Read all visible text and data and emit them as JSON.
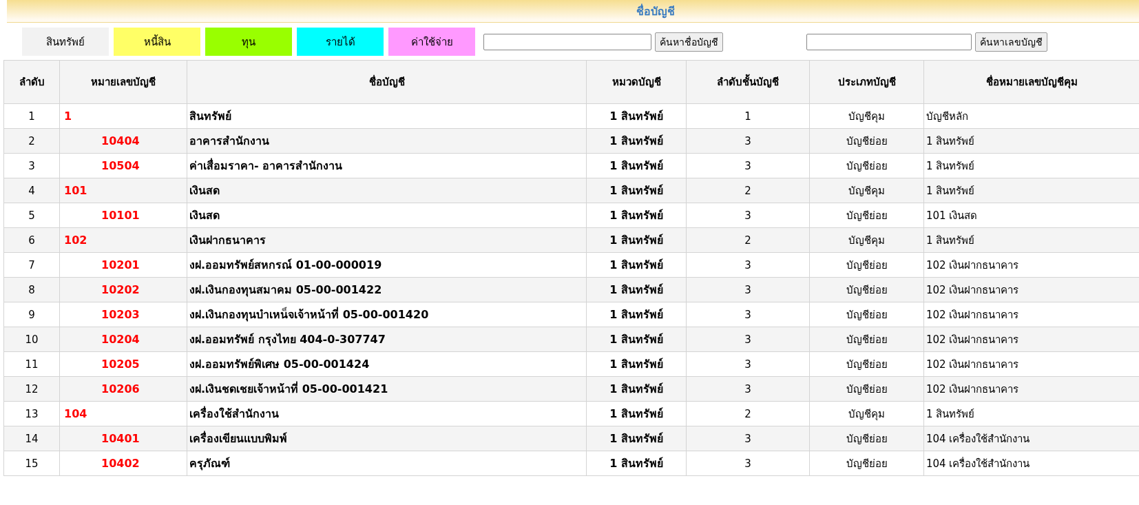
{
  "page_title": "ชื่อบัญชี",
  "categories": [
    {
      "label": "สินทรัพย์",
      "color": "#f2f2f2"
    },
    {
      "label": "หนี้สิน",
      "color": "#ffff66"
    },
    {
      "label": "ทุน",
      "color": "#99ff00"
    },
    {
      "label": "รายได้",
      "color": "#00ffff"
    },
    {
      "label": "ค่าใช้จ่าย",
      "color": "#ff99ff"
    }
  ],
  "searches": [
    {
      "button": "ค้นหาชื่อบัญชี"
    },
    {
      "button": "ค้นหาเลขบัญชี"
    }
  ],
  "table": {
    "columns": [
      "ลำดับ",
      "หมายเลขบัญชี",
      "ชื่อบัญชี",
      "หมวดบัญชี",
      "ลำดับชั้นบัญชี",
      "ประเภทบัญชี",
      "ชื่อหมายเลขบัญชีคุม"
    ],
    "rows": [
      {
        "kind": "control",
        "no": "1",
        "account_no": "1",
        "name": "สินทรัพย์",
        "category": "1 สินทรัพย์",
        "level": "1",
        "type": "บัญชีคุม",
        "parent": "บัญชีหลัก"
      },
      {
        "kind": "sub",
        "no": "2",
        "account_no": "10404",
        "name": "อาคารสำนักงาน",
        "category": "1 สินทรัพย์",
        "level": "3",
        "type": "บัญชีย่อย",
        "parent": "1 สินทรัพย์"
      },
      {
        "kind": "sub",
        "no": "3",
        "account_no": "10504",
        "name": "ค่าเสื่อมราคา- อาคารสำนักงาน",
        "category": "1 สินทรัพย์",
        "level": "3",
        "type": "บัญชีย่อย",
        "parent": "1 สินทรัพย์"
      },
      {
        "kind": "control",
        "no": "4",
        "account_no": "101",
        "name": "เงินสด",
        "category": "1 สินทรัพย์",
        "level": "2",
        "type": "บัญชีคุม",
        "parent": "1 สินทรัพย์"
      },
      {
        "kind": "sub",
        "no": "5",
        "account_no": "10101",
        "name": "เงินสด",
        "category": "1 สินทรัพย์",
        "level": "3",
        "type": "บัญชีย่อย",
        "parent": "101 เงินสด"
      },
      {
        "kind": "control",
        "no": "6",
        "account_no": "102",
        "name": "เงินฝากธนาคาร",
        "category": "1 สินทรัพย์",
        "level": "2",
        "type": "บัญชีคุม",
        "parent": "1 สินทรัพย์"
      },
      {
        "kind": "sub",
        "no": "7",
        "account_no": "10201",
        "name": "งฝ.ออมทรัพย์สหกรณ์ 01-00-000019",
        "category": "1 สินทรัพย์",
        "level": "3",
        "type": "บัญชีย่อย",
        "parent": "102 เงินฝากธนาคาร"
      },
      {
        "kind": "sub",
        "no": "8",
        "account_no": "10202",
        "name": "งฝ.เงินกองทุนสมาคม 05-00-001422",
        "category": "1 สินทรัพย์",
        "level": "3",
        "type": "บัญชีย่อย",
        "parent": "102 เงินฝากธนาคาร"
      },
      {
        "kind": "sub",
        "no": "9",
        "account_no": "10203",
        "name": "งฝ.เงินกองทุนบำเหน็จเจ้าหน้าที่ 05-00-001420",
        "category": "1 สินทรัพย์",
        "level": "3",
        "type": "บัญชีย่อย",
        "parent": "102 เงินฝากธนาคาร"
      },
      {
        "kind": "sub",
        "no": "10",
        "account_no": "10204",
        "name": "งฝ.ออมทรัพย์ กรุงไทย 404-0-307747",
        "category": "1 สินทรัพย์",
        "level": "3",
        "type": "บัญชีย่อย",
        "parent": "102 เงินฝากธนาคาร"
      },
      {
        "kind": "sub",
        "no": "11",
        "account_no": "10205",
        "name": "งฝ.ออมทรัพย์พิเศษ 05-00-001424",
        "category": "1 สินทรัพย์",
        "level": "3",
        "type": "บัญชีย่อย",
        "parent": "102 เงินฝากธนาคาร"
      },
      {
        "kind": "sub",
        "no": "12",
        "account_no": "10206",
        "name": "งฝ.เงินชดเชยเจ้าหน้าที่ 05-00-001421",
        "category": "1 สินทรัพย์",
        "level": "3",
        "type": "บัญชีย่อย",
        "parent": "102 เงินฝากธนาคาร"
      },
      {
        "kind": "control",
        "no": "13",
        "account_no": "104",
        "name": "เครื่องใช้สำนักงาน",
        "category": "1 สินทรัพย์",
        "level": "2",
        "type": "บัญชีคุม",
        "parent": "1 สินทรัพย์"
      },
      {
        "kind": "sub",
        "no": "14",
        "account_no": "10401",
        "name": "เครื่องเขียนแบบพิมพ์",
        "category": "1 สินทรัพย์",
        "level": "3",
        "type": "บัญชีย่อย",
        "parent": "104 เครื่องใช้สำนักงาน"
      },
      {
        "kind": "sub",
        "no": "15",
        "account_no": "10402",
        "name": "ครุภัณฑ์",
        "category": "1 สินทรัพย์",
        "level": "3",
        "type": "บัญชีย่อย",
        "parent": "104 เครื่องใช้สำนักงาน"
      }
    ]
  }
}
